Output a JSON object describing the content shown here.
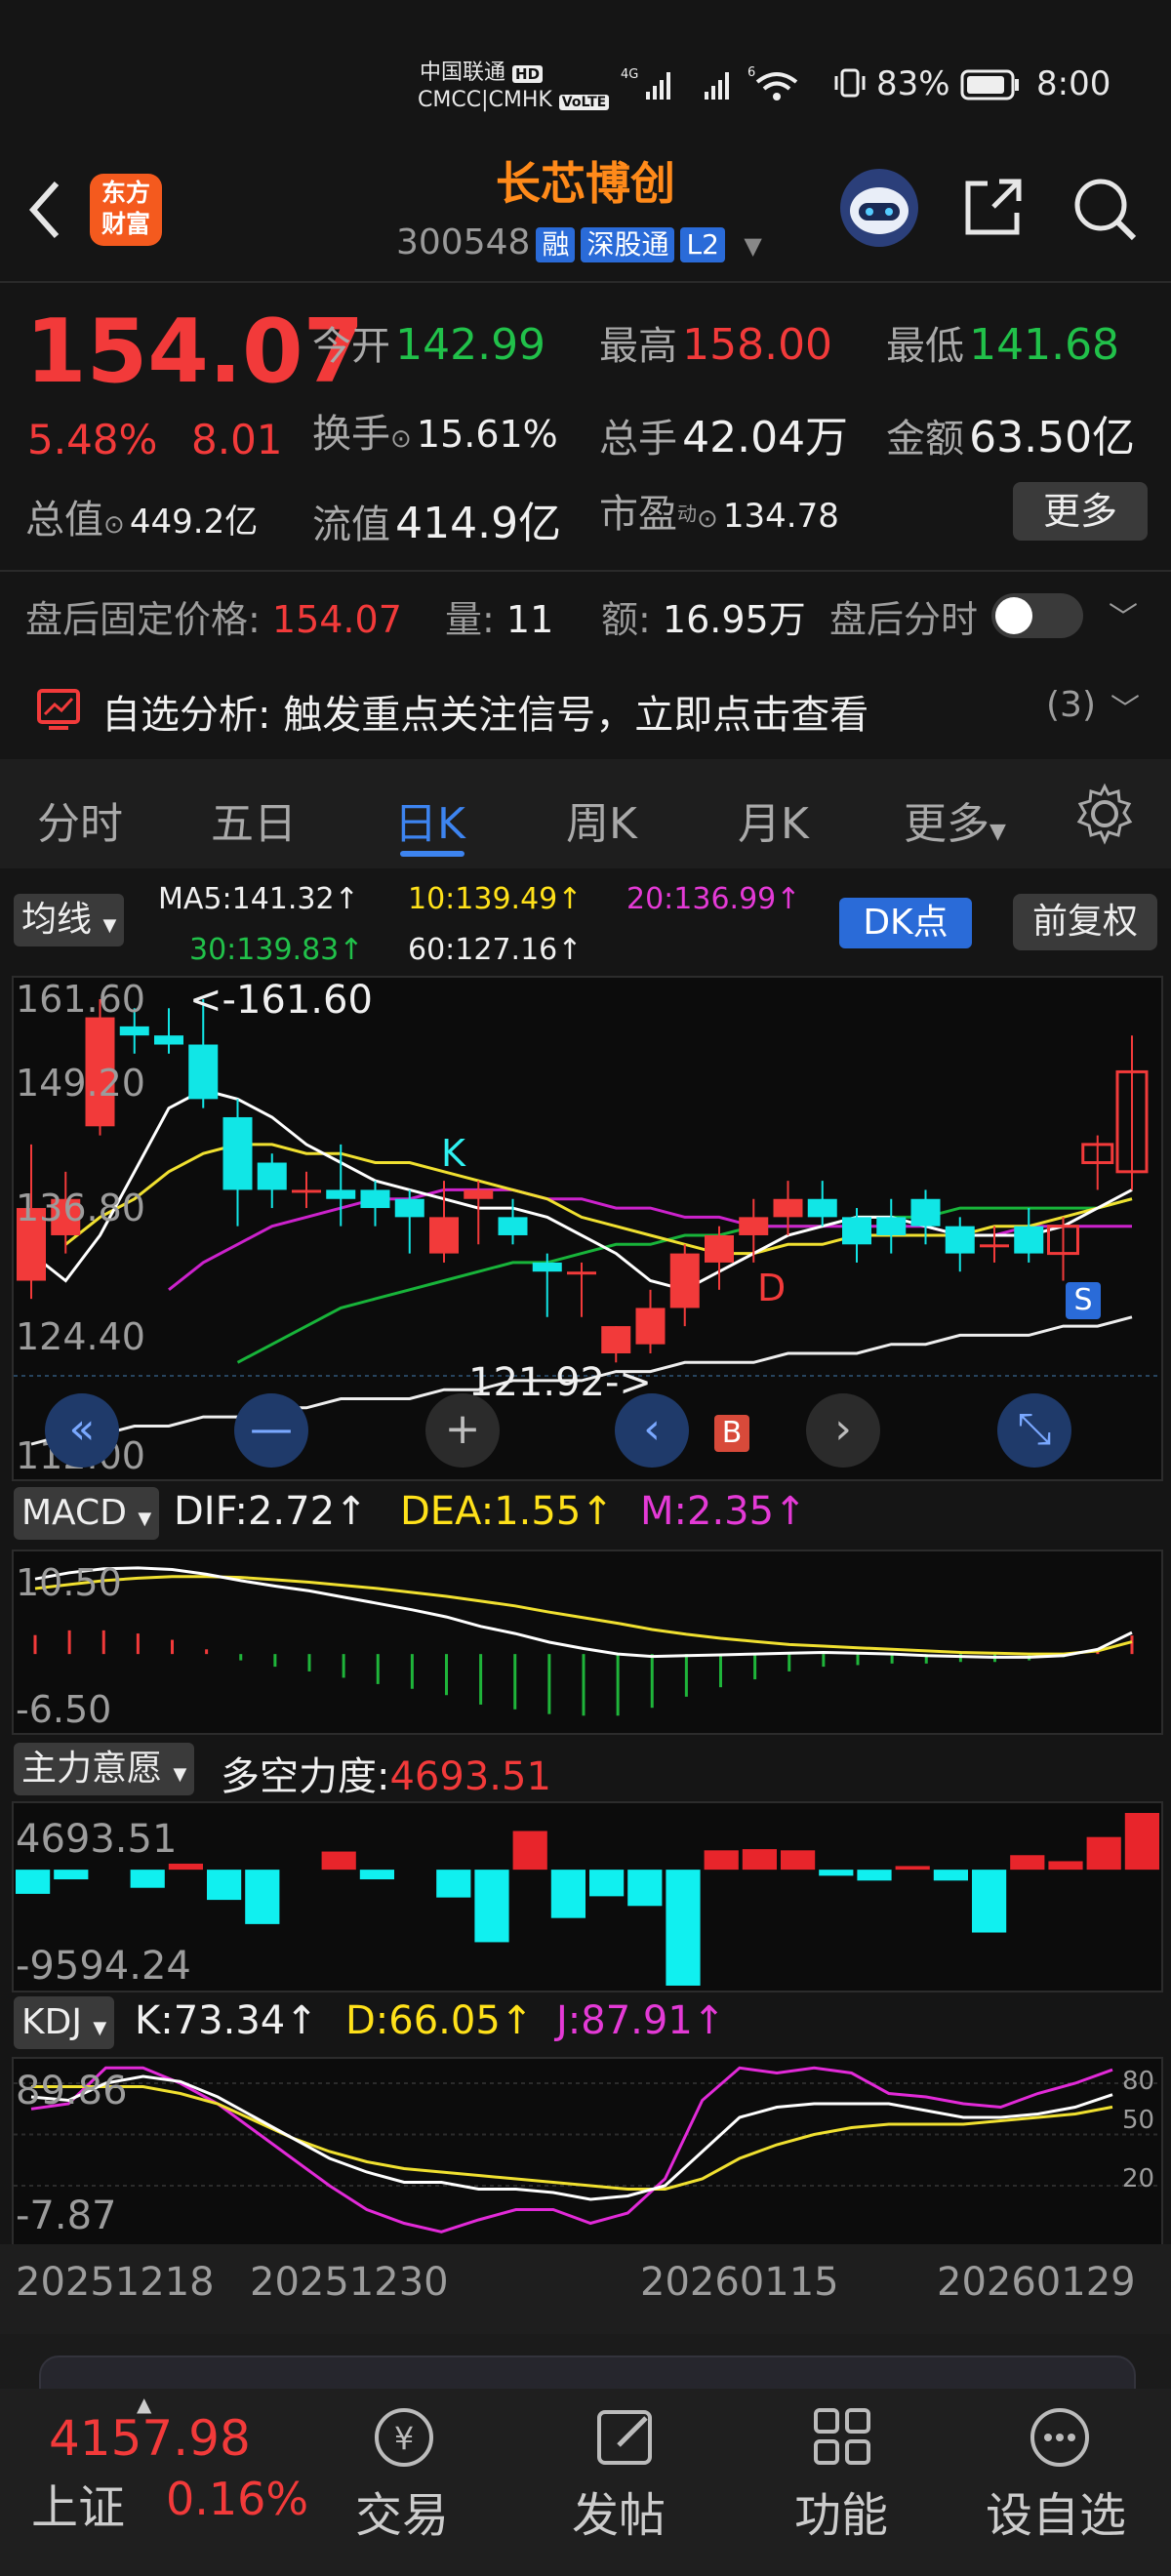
{
  "status_bar": {
    "carrier_top": "中国联通",
    "carrier_hd": "HD",
    "carrier_bottom": "CMCC|CMHK",
    "volte": "VoLTE",
    "net1": "4G",
    "net2": "6",
    "battery": "83%",
    "time": "8:00"
  },
  "header": {
    "logo": "东方财富",
    "title": "长芯博创",
    "code": "300548",
    "tags": [
      "融",
      "深股通",
      "L2"
    ]
  },
  "quote": {
    "price": "154.07",
    "change_pct": "5.48%",
    "change": "8.01",
    "open_label": "今开",
    "open": "142.99",
    "high_label": "最高",
    "high": "158.00",
    "low_label": "最低",
    "low": "141.68",
    "turnover_label": "换手",
    "turnover": "15.61%",
    "volume_label": "总手",
    "volume": "42.04万",
    "amount_label": "金额",
    "amount": "63.50亿",
    "total_mv_label": "总值",
    "total_mv": "449.2亿",
    "float_mv_label": "流值",
    "float_mv": "414.9亿",
    "pe_label": "市盈",
    "pe_sup": "动",
    "pe": "134.78",
    "more": "更多"
  },
  "after_hours": {
    "price_label": "盘后固定价格:",
    "price": "154.07",
    "vol_label": "量:",
    "vol": "11",
    "amt_label": "额:",
    "amt": "16.95万",
    "intraday_label": "盘后分时"
  },
  "analysis": {
    "text": "自选分析: 触发重点关注信号，立即点击查看",
    "count": "(3)"
  },
  "tabs": [
    "分时",
    "五日",
    "日K",
    "周K",
    "月K",
    "更多"
  ],
  "active_tab": "日K",
  "ma_bar": {
    "selector": "均线",
    "ma5": "MA5:141.32↑",
    "ma10": "10:139.49↑",
    "ma20": "20:136.99↑",
    "ma30": "30:139.83↑",
    "ma60": "60:127.16↑",
    "dk": "DK点",
    "adjust": "前复权"
  },
  "kline": {
    "y_labels": [
      "161.60",
      "149.20",
      "136.80",
      "124.40",
      "112.00"
    ],
    "max_note": "<-161.60",
    "min_note": "121.92->",
    "markers": {
      "k": "K",
      "d": "D",
      "b": "B",
      "s": "S"
    },
    "candles": [
      {
        "o": 131,
        "h": 146,
        "l": 129,
        "c": 139
      },
      {
        "o": 136,
        "h": 143,
        "l": 134,
        "c": 140
      },
      {
        "o": 148,
        "h": 162,
        "l": 147,
        "c": 160
      },
      {
        "o": 159,
        "h": 161,
        "l": 156,
        "c": 158
      },
      {
        "o": 158,
        "h": 161,
        "l": 156,
        "c": 157
      },
      {
        "o": 157,
        "h": 162,
        "l": 150,
        "c": 151
      },
      {
        "o": 149,
        "h": 151,
        "l": 137,
        "c": 141
      },
      {
        "o": 144,
        "h": 145,
        "l": 139,
        "c": 141
      },
      {
        "o": 141,
        "h": 143,
        "l": 139,
        "c": 141
      },
      {
        "o": 141,
        "h": 146,
        "l": 137,
        "c": 140
      },
      {
        "o": 141,
        "h": 142,
        "l": 137,
        "c": 139
      },
      {
        "o": 140,
        "h": 141,
        "l": 134,
        "c": 138
      },
      {
        "o": 134,
        "h": 142,
        "l": 133,
        "c": 138
      },
      {
        "o": 140,
        "h": 142,
        "l": 135,
        "c": 141
      },
      {
        "o": 138,
        "h": 140,
        "l": 135,
        "c": 136
      },
      {
        "o": 133,
        "h": 134,
        "l": 127,
        "c": 132
      },
      {
        "o": 132,
        "h": 133,
        "l": 127,
        "c": 132
      },
      {
        "o": 123,
        "h": 126,
        "l": 122,
        "c": 126
      },
      {
        "o": 124,
        "h": 130,
        "l": 123,
        "c": 128
      },
      {
        "o": 128,
        "h": 135,
        "l": 126,
        "c": 134
      },
      {
        "o": 133,
        "h": 137,
        "l": 130,
        "c": 136
      },
      {
        "o": 136,
        "h": 140,
        "l": 133,
        "c": 138
      },
      {
        "o": 138,
        "h": 142,
        "l": 136,
        "c": 140
      },
      {
        "o": 140,
        "h": 142,
        "l": 137,
        "c": 138
      },
      {
        "o": 138,
        "h": 139,
        "l": 133,
        "c": 135
      },
      {
        "o": 138,
        "h": 140,
        "l": 134,
        "c": 136
      },
      {
        "o": 140,
        "h": 141,
        "l": 135,
        "c": 137
      },
      {
        "o": 137,
        "h": 138,
        "l": 132,
        "c": 134
      },
      {
        "o": 135,
        "h": 137,
        "l": 133,
        "c": 135
      },
      {
        "o": 137,
        "h": 139,
        "l": 133,
        "c": 134
      },
      {
        "o": 134,
        "h": 138,
        "l": 131,
        "c": 137
      },
      {
        "o": 144,
        "h": 147,
        "l": 141,
        "c": 146
      },
      {
        "o": 143,
        "h": 158,
        "l": 141,
        "c": 154
      }
    ],
    "ma5": [
      134,
      131,
      136,
      143,
      150,
      152,
      151,
      149,
      146,
      144,
      142,
      141,
      140,
      139,
      139,
      138,
      136,
      134,
      131,
      130,
      132,
      134,
      136,
      137,
      138,
      138,
      137,
      136,
      136,
      136,
      137,
      139,
      141
    ],
    "ma10": [
      null,
      135,
      138,
      140,
      143,
      145,
      146,
      146,
      145,
      145,
      144,
      144,
      143,
      142,
      141,
      140,
      138,
      137,
      136,
      135,
      134,
      134,
      135,
      135,
      136,
      136,
      136,
      136,
      137,
      137,
      138,
      139,
      140
    ],
    "ma20": [
      null,
      null,
      null,
      null,
      130,
      133,
      135,
      137,
      138,
      139,
      140,
      140,
      141,
      141,
      141,
      140,
      140,
      139,
      139,
      138,
      138,
      137,
      137,
      137,
      137,
      137,
      137,
      136,
      136,
      137,
      137,
      137,
      137
    ],
    "ma30": [
      null,
      null,
      null,
      null,
      null,
      null,
      122,
      124,
      126,
      128,
      129,
      130,
      131,
      132,
      133,
      133,
      134,
      135,
      135,
      136,
      136,
      137,
      137,
      137,
      138,
      138,
      138,
      139,
      139,
      139,
      139,
      139,
      140
    ],
    "ma60": [
      113,
      114,
      114,
      115,
      115,
      116,
      116,
      117,
      117,
      118,
      118,
      118,
      119,
      119,
      120,
      120,
      120,
      121,
      121,
      122,
      122,
      122,
      123,
      123,
      123,
      124,
      124,
      125,
      125,
      125,
      126,
      126,
      127
    ]
  },
  "macd": {
    "selector": "MACD",
    "dif": "DIF:2.72↑",
    "dea": "DEA:1.55↑",
    "m": "M:2.35↑",
    "y_labels": [
      "10.50",
      "-6.50"
    ],
    "dif_series": [
      9.5,
      10.3,
      10.8,
      10.9,
      10.7,
      10.1,
      9.3,
      8.6,
      8.0,
      7.2,
      6.4,
      5.6,
      4.7,
      3.5,
      2.6,
      1.5,
      0.7,
      0.0,
      -0.3,
      -0.2,
      -0.1,
      0.0,
      0.1,
      0.2,
      0.1,
      0.0,
      -0.2,
      -0.3,
      -0.4,
      -0.4,
      -0.2,
      0.6,
      2.72
    ],
    "dea_series": [
      8.3,
      8.8,
      9.3,
      9.6,
      9.8,
      9.8,
      9.7,
      9.4,
      9.1,
      8.7,
      8.3,
      7.8,
      7.3,
      6.7,
      6.1,
      5.3,
      4.6,
      3.9,
      3.1,
      2.5,
      2.0,
      1.6,
      1.2,
      1.0,
      0.8,
      0.6,
      0.4,
      0.2,
      0.1,
      0.0,
      0.0,
      0.4,
      1.55
    ],
    "hist": [
      2.4,
      3.0,
      3.0,
      2.6,
      1.8,
      0.6,
      -0.8,
      -1.6,
      -2.2,
      -3.0,
      -3.8,
      -4.4,
      -5.2,
      -6.4,
      -7.0,
      -7.6,
      -7.8,
      -7.8,
      -6.8,
      -5.4,
      -4.2,
      -3.2,
      -2.2,
      -1.6,
      -1.4,
      -1.2,
      -1.2,
      -1.0,
      -1.0,
      -0.8,
      -0.4,
      0.4,
      2.35
    ]
  },
  "force": {
    "selector": "主力意愿",
    "label": "多空力度:",
    "value": "4693.51",
    "y_labels": [
      "4693.51",
      "-9594.24"
    ],
    "bars": [
      -2000,
      -800,
      0,
      -1500,
      500,
      -2500,
      -4500,
      0,
      1500,
      -800,
      0,
      -2300,
      -6000,
      3200,
      -4000,
      -2200,
      -3000,
      -9594,
      1600,
      1700,
      1600,
      -500,
      -900,
      300,
      -900,
      -5200,
      1200,
      700,
      2700,
      4693
    ]
  },
  "kdj": {
    "selector": "KDJ",
    "k": "K:73.34↑",
    "d": "D:66.05↑",
    "j": "J:87.91↑",
    "y_labels": [
      "89.86",
      "-7.87"
    ],
    "right_labels": [
      "80",
      "50",
      "20"
    ],
    "k_series": [
      72,
      70,
      80,
      84,
      81,
      72,
      60,
      48,
      36,
      28,
      22,
      22,
      18,
      18,
      16,
      12,
      14,
      20,
      40,
      60,
      66,
      68,
      68,
      68,
      64,
      60,
      60,
      62,
      66,
      73.34
    ],
    "d_series": [
      78,
      78,
      78,
      78,
      74,
      68,
      58,
      48,
      40,
      34,
      30,
      28,
      26,
      24,
      22,
      20,
      18,
      18,
      24,
      36,
      44,
      50,
      54,
      56,
      56,
      56,
      58,
      60,
      62,
      66.05
    ],
    "j_series": [
      65,
      68,
      89,
      89,
      80,
      68,
      52,
      36,
      20,
      6,
      -2,
      -7,
      0,
      6,
      6,
      -2,
      4,
      24,
      70,
      89,
      86,
      89,
      86,
      74,
      72,
      68,
      66,
      74,
      80,
      87.91
    ],
    "dates": [
      "20251218",
      "20251230",
      "20260115",
      "20260129"
    ]
  },
  "ctl_icons": [
    "double-left-icon",
    "zoom-out-icon",
    "zoom-in-icon",
    "left-icon",
    "right-icon",
    "fullscreen-icon"
  ],
  "bottom_bar": {
    "index_value": "4157.98",
    "index_name": "上证",
    "index_pct": "0.16%",
    "items": [
      "交易",
      "发帖",
      "功能",
      "设自选"
    ]
  },
  "colors": {
    "up": "#f23a3a",
    "down": "#11e6e6",
    "accent": "#2a6bd8",
    "brand": "#ff8a1a"
  }
}
